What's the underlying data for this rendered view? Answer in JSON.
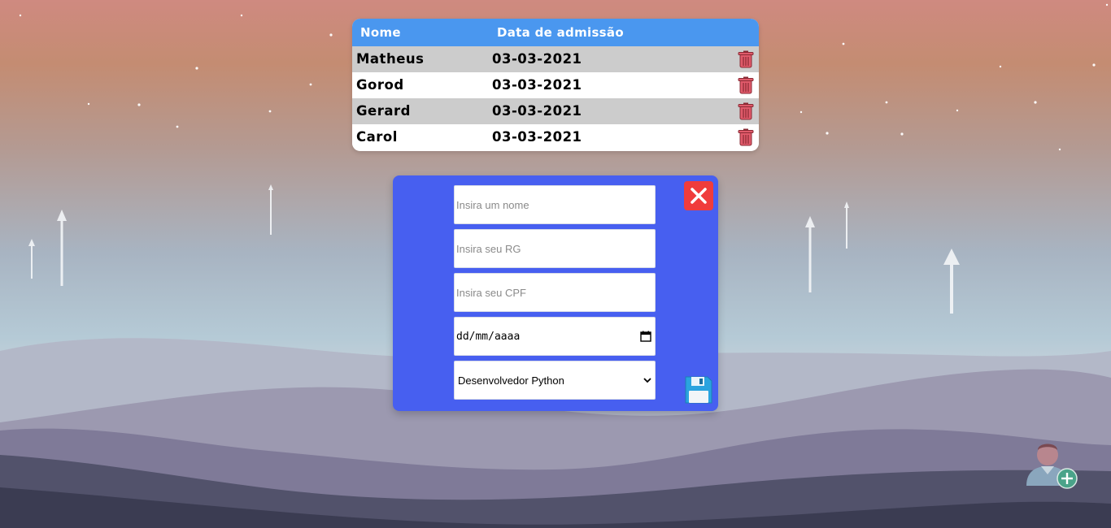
{
  "table": {
    "headers": [
      "Nome",
      "Data de admissão"
    ],
    "rows": [
      {
        "name": "Matheus",
        "date": "03-03-2021"
      },
      {
        "name": "Gorod",
        "date": "03-03-2021"
      },
      {
        "name": "Gerard",
        "date": "03-03-2021"
      },
      {
        "name": "Carol",
        "date": "03-03-2021"
      }
    ]
  },
  "form": {
    "name_placeholder": "Insira um nome",
    "rg_placeholder": "Insira seu RG",
    "cpf_placeholder": "Insira seu CPF",
    "date_placeholder": "dd/mm/aaaa",
    "role_selected": "Desenvolvedor Python"
  },
  "icons": {
    "delete": "trash-icon",
    "close": "close-icon",
    "save": "floppy-disk-icon",
    "add_user": "add-user-icon",
    "calendar": "calendar-icon",
    "dropdown": "chevron-down-icon"
  },
  "colors": {
    "table_header": "#4a97ef",
    "row_alt": "#cccccc",
    "modal_bg": "#475ff0",
    "close_button": "#f03c3c",
    "trash": "#e05a6a"
  }
}
